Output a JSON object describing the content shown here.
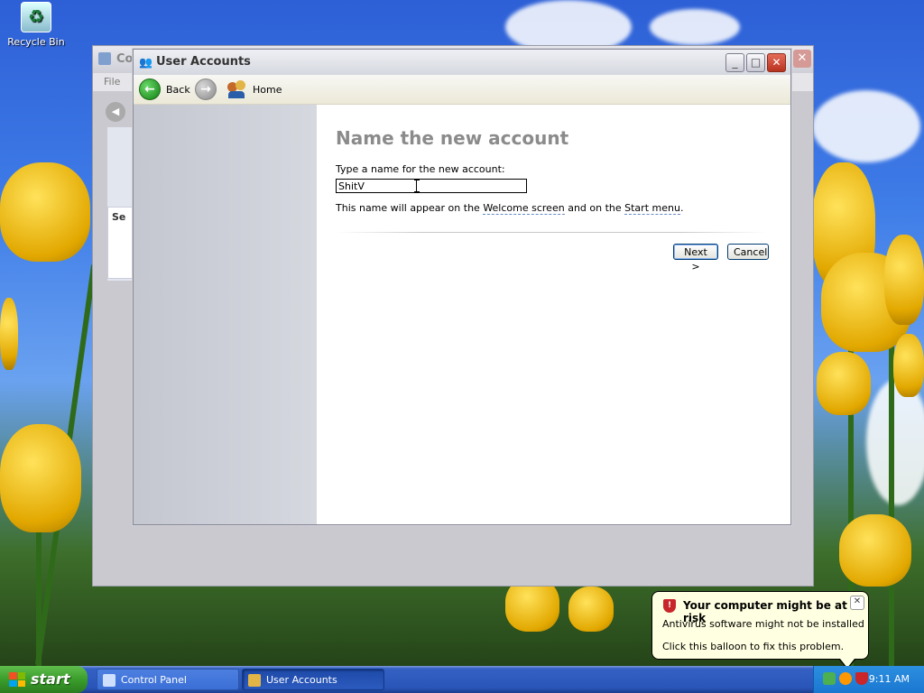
{
  "desktop": {
    "recycle_bin_label": "Recycle Bin"
  },
  "background_window": {
    "title": "Con",
    "menu_file": "File",
    "side_label": "Se"
  },
  "window": {
    "title": "User Accounts",
    "controls": {
      "minimize": "_",
      "maximize": "□",
      "close": "✕"
    }
  },
  "toolbar": {
    "back_label": "Back",
    "home_label": "Home"
  },
  "content": {
    "heading": "Name the new account",
    "prompt": "Type a name for the new account:",
    "name_value": "ShitV",
    "info_prefix": "This name will appear on the ",
    "welcome_link": "Welcome screen",
    "info_middle": " and on the ",
    "start_link": "Start menu",
    "info_suffix": ".",
    "next_label": "Next >",
    "cancel_label": "Cancel"
  },
  "balloon": {
    "title": "Your computer might be at risk",
    "line1": "Antivirus software might not be installed",
    "line2": "Click this balloon to fix this problem.",
    "close": "✕"
  },
  "taskbar": {
    "start_label": "start",
    "tasks": [
      {
        "label": "Control Panel",
        "active": false
      },
      {
        "label": "User Accounts",
        "active": true
      }
    ],
    "clock": "9:11 AM"
  },
  "colors": {
    "title_bar": "#d6d8e0",
    "accent_green": "#2a9a2a",
    "taskbar_blue": "#2a55b8",
    "alert_red": "#c8262a",
    "balloon_bg": "#ffffe1"
  }
}
